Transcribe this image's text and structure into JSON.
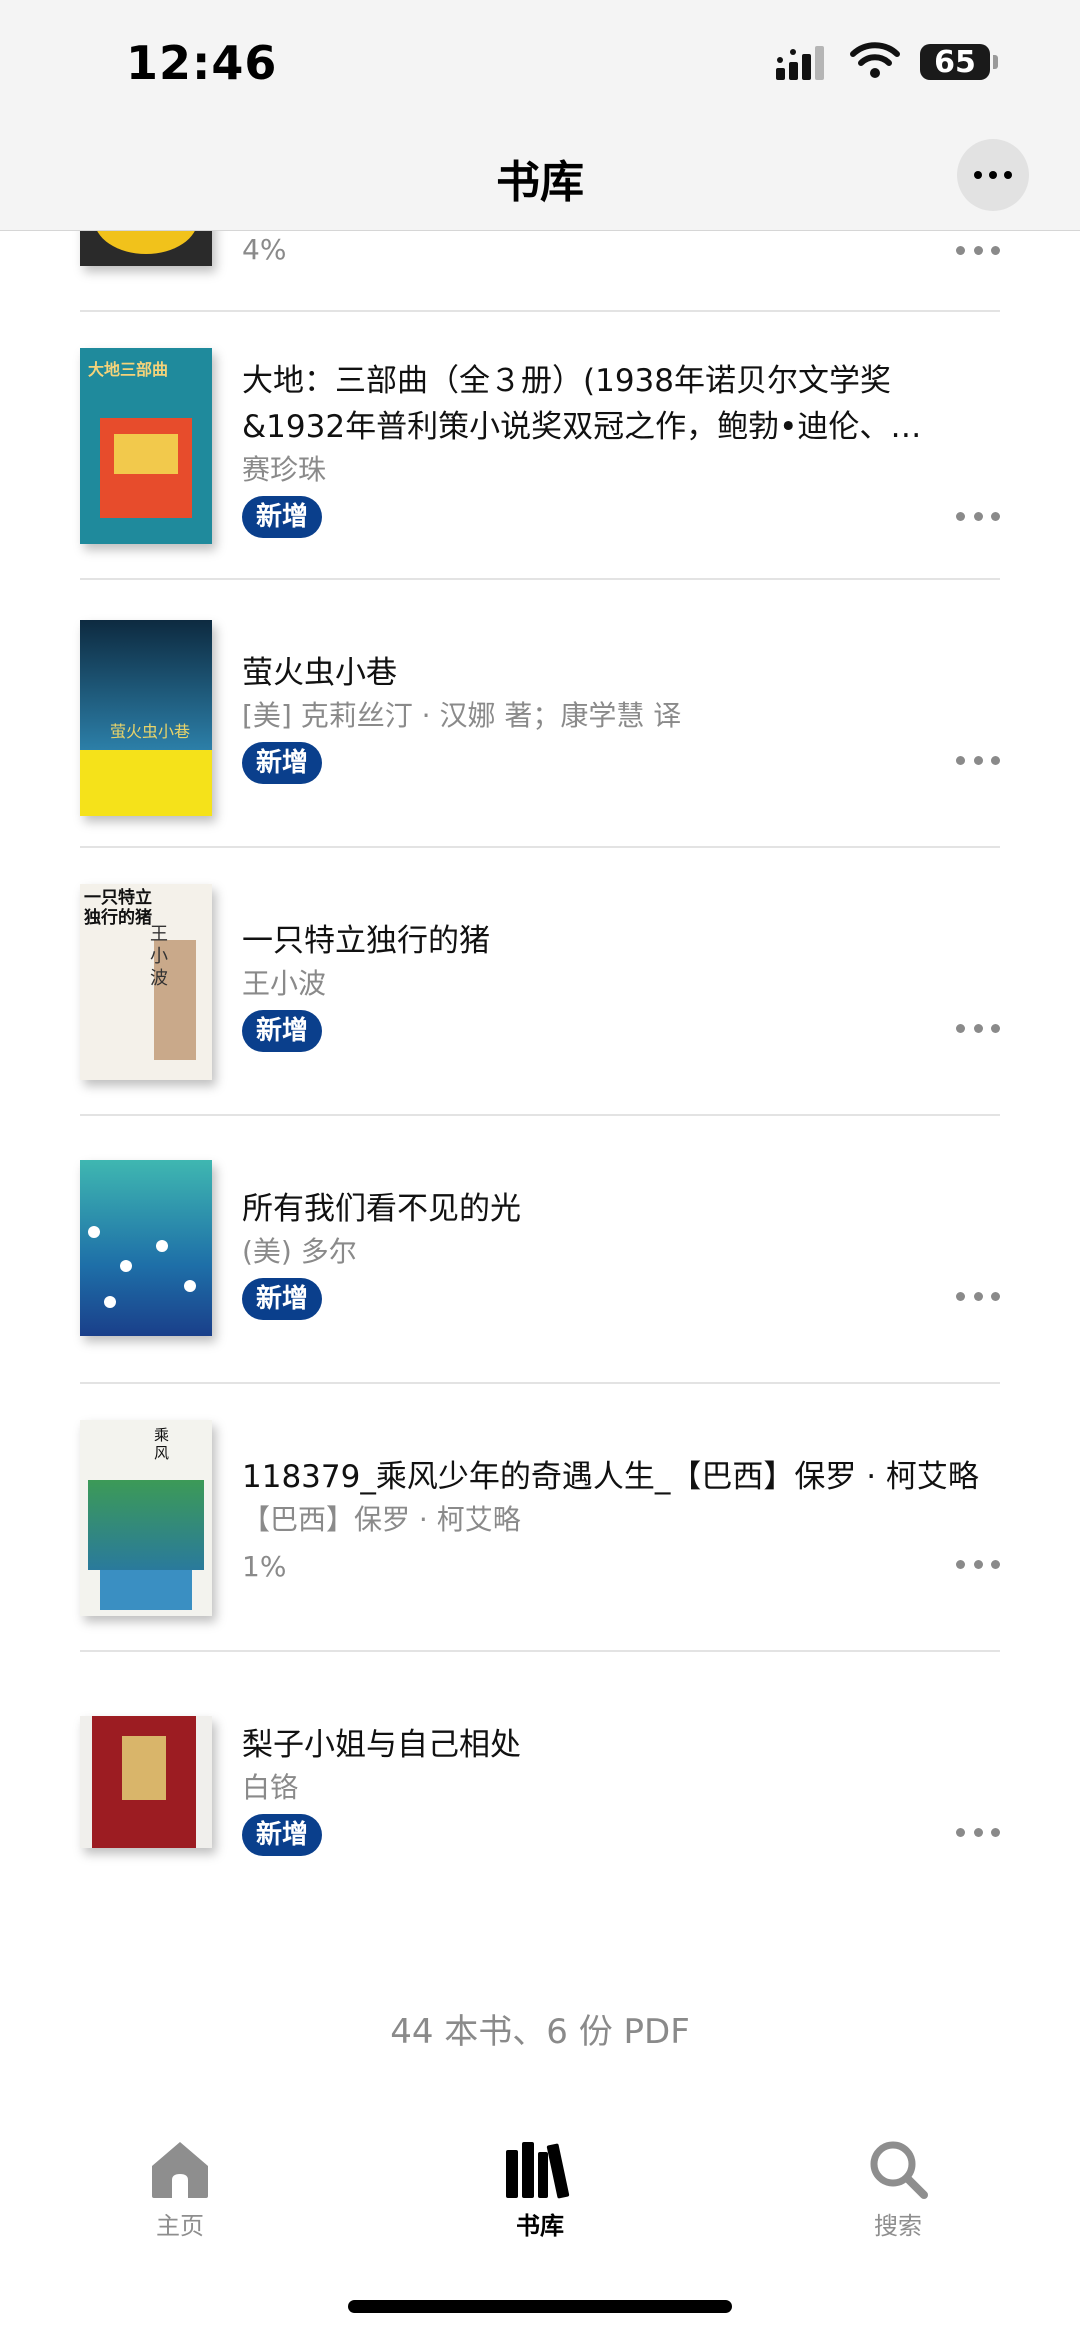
{
  "status_bar": {
    "time": "12:46",
    "battery": "65"
  },
  "header": {
    "title": "书库"
  },
  "top_partial": {
    "progress": "4%"
  },
  "books": [
    {
      "title": "大地：三部曲（全３册）(1938年诺贝尔文学奖&1932年普利策小说奖双冠之作，鲍勃•迪伦、奥…",
      "author": "赛珍珠",
      "badge": "新增"
    },
    {
      "title": "萤火虫小巷",
      "author": "[美] 克莉丝汀 · 汉娜 著；康学慧 译",
      "badge": "新增"
    },
    {
      "title": "一只特立独行的猪",
      "author": "王小波",
      "badge": "新增"
    },
    {
      "title": "所有我们看不见的光",
      "author": "(美) 多尔",
      "badge": "新增"
    },
    {
      "title": "118379_乘风少年的奇遇人生_【巴西】保罗 · 柯艾略",
      "author": "【巴西】保罗 · 柯艾略",
      "progress": "1%"
    },
    {
      "title": "梨子小姐与自己相处",
      "author": "白铬",
      "badge": "新增"
    }
  ],
  "summary": "44 本书、6 份 PDF",
  "tabs": [
    {
      "label": "主页",
      "icon": "home-icon"
    },
    {
      "label": "书库",
      "icon": "library-icon",
      "active": true
    },
    {
      "label": "搜索",
      "icon": "search-icon"
    }
  ],
  "colors": {
    "badge_bg": "#0a3f8c",
    "muted": "#8a8a8a",
    "topbar_bg": "#f4f4f4"
  }
}
